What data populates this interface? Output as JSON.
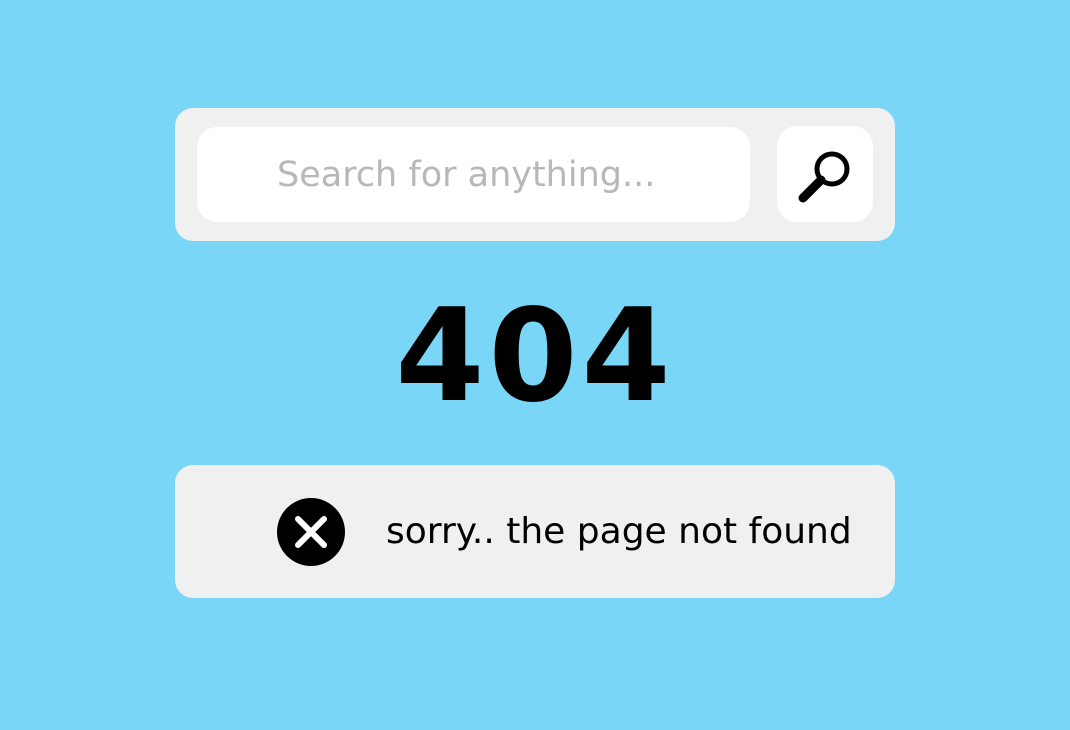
{
  "search": {
    "placeholder": "Search for anything..."
  },
  "icons": {
    "search": "magnifying-glass-icon",
    "error": "close-circle-icon"
  },
  "error": {
    "code": "404",
    "message": "sorry.. the page not found"
  },
  "colors": {
    "background": "#7ad6f6",
    "panel": "#f0f0f0",
    "field": "#ffffff",
    "text": "#000000",
    "placeholder": "#b8b8b8"
  }
}
